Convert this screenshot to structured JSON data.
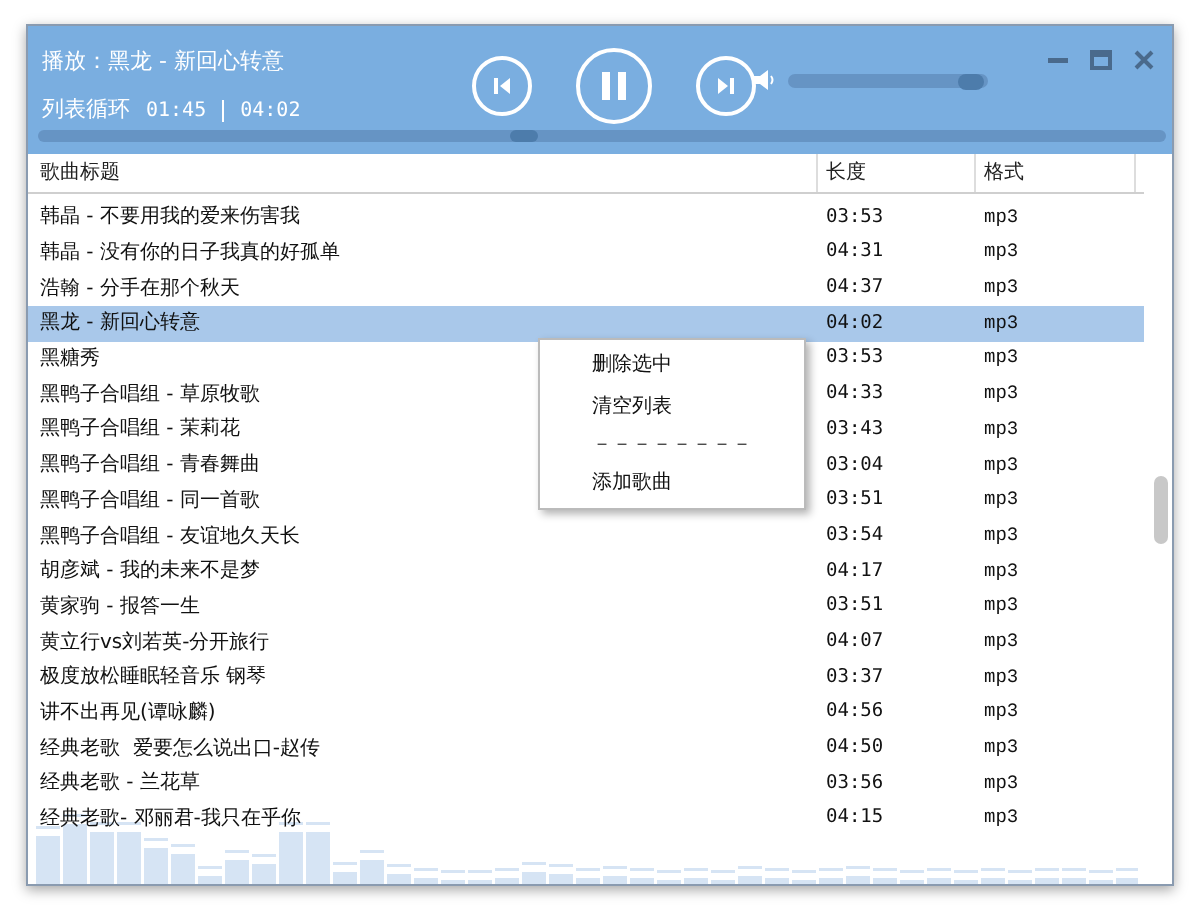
{
  "player": {
    "now_playing": "播放：黑龙 - 新回心转意",
    "mode": "列表循环",
    "elapsed": "01:45",
    "total": "04:02",
    "playing": true,
    "volume": {
      "level": 0.92
    },
    "progress": {
      "level": 0.43
    }
  },
  "table": {
    "columns": [
      "歌曲标题",
      "长度",
      "格式"
    ],
    "rows": [
      {
        "title": "韩晶 - 不要用我的爱来伤害我",
        "length": "03:53",
        "format": "mp3",
        "selected": false
      },
      {
        "title": "韩晶 - 没有你的日子我真的好孤单",
        "length": "04:31",
        "format": "mp3",
        "selected": false
      },
      {
        "title": "浩翰 - 分手在那个秋天",
        "length": "04:37",
        "format": "mp3",
        "selected": false
      },
      {
        "title": "黑龙 - 新回心转意",
        "length": "04:02",
        "format": "mp3",
        "selected": true
      },
      {
        "title": "黑糖秀",
        "length": "03:53",
        "format": "mp3",
        "selected": false
      },
      {
        "title": "黑鸭子合唱组 - 草原牧歌",
        "length": "04:33",
        "format": "mp3",
        "selected": false
      },
      {
        "title": "黑鸭子合唱组 - 茉莉花",
        "length": "03:43",
        "format": "mp3",
        "selected": false
      },
      {
        "title": "黑鸭子合唱组 - 青春舞曲",
        "length": "03:04",
        "format": "mp3",
        "selected": false
      },
      {
        "title": "黑鸭子合唱组 - 同一首歌",
        "length": "03:51",
        "format": "mp3",
        "selected": false
      },
      {
        "title": "黑鸭子合唱组 - 友谊地久天长",
        "length": "03:54",
        "format": "mp3",
        "selected": false
      },
      {
        "title": "胡彦斌 - 我的未来不是梦",
        "length": "04:17",
        "format": "mp3",
        "selected": false
      },
      {
        "title": "黄家驹 - 报答一生",
        "length": "03:51",
        "format": "mp3",
        "selected": false
      },
      {
        "title": "黄立行vs刘若英-分开旅行",
        "length": "04:07",
        "format": "mp3",
        "selected": false
      },
      {
        "title": "极度放松睡眠轻音乐 钢琴",
        "length": "03:37",
        "format": "mp3",
        "selected": false
      },
      {
        "title": "讲不出再见(谭咏麟)",
        "length": "04:56",
        "format": "mp3",
        "selected": false
      },
      {
        "title": "经典老歌  爱要怎么说出口-赵传",
        "length": "04:50",
        "format": "mp3",
        "selected": false
      },
      {
        "title": "经典老歌 - 兰花草",
        "length": "03:56",
        "format": "mp3",
        "selected": false
      },
      {
        "title": "经典老歌- 邓丽君-我只在乎你",
        "length": "04:15",
        "format": "mp3",
        "selected": false
      }
    ]
  },
  "context_menu": {
    "items": [
      {
        "kind": "item",
        "label": "删除选中"
      },
      {
        "kind": "item",
        "label": "清空列表"
      },
      {
        "kind": "separator",
        "label": "－－－－－－－－"
      },
      {
        "kind": "item",
        "label": "添加歌曲"
      }
    ]
  }
}
